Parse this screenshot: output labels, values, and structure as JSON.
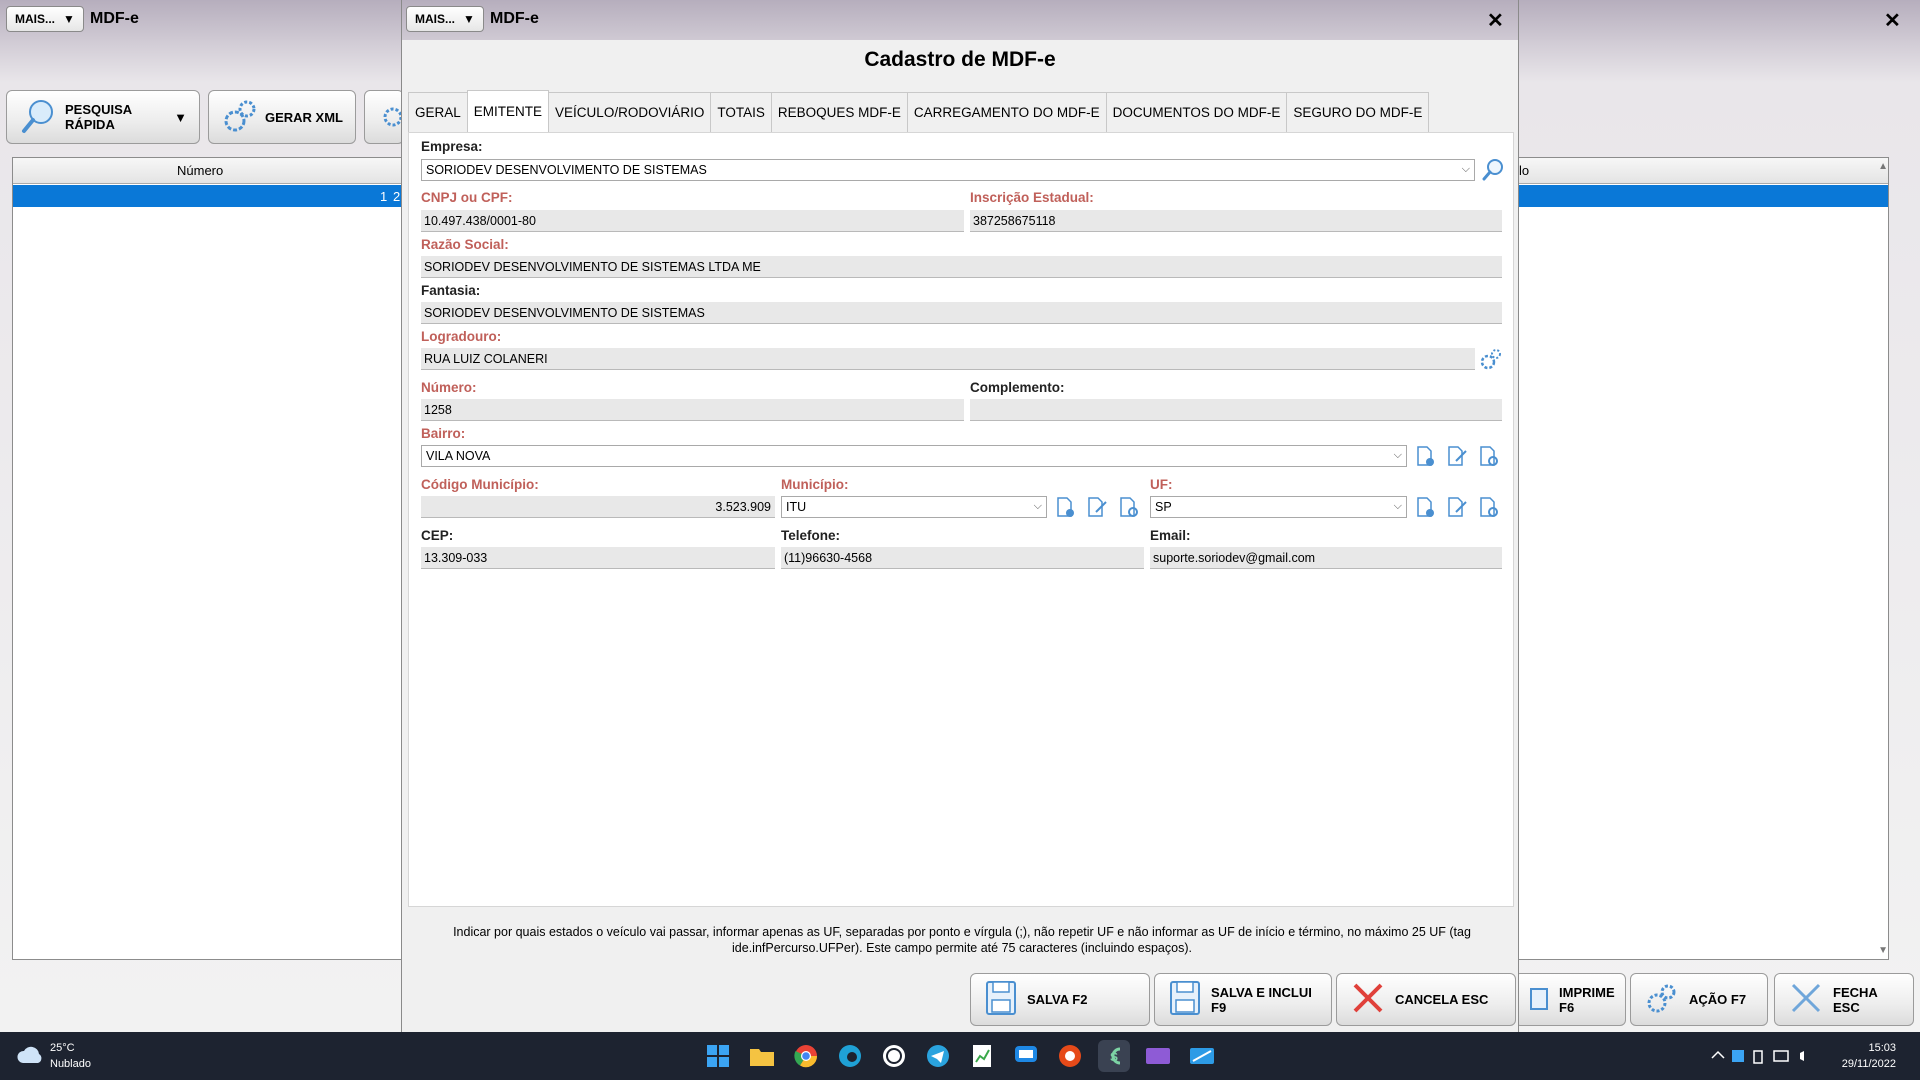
{
  "background_window": {
    "more_button": "MAIS...",
    "title": "MDF-e",
    "toolbar": {
      "quick_search": "PESQUISA RÁPIDA",
      "generate_xml": "GERAR XML"
    },
    "grid": {
      "col_numero": "Número",
      "col_right": "lo",
      "selected_row_value": "1",
      "selected_row_value2": "2"
    },
    "bottom": {
      "print": "IMPRIME F6",
      "action": "AÇÃO F7",
      "close": "FECHA ESC"
    }
  },
  "modal": {
    "more_button": "MAIS...",
    "window_title": "MDF-e",
    "heading": "Cadastro de MDF-e",
    "tabs": [
      {
        "label": "GERAL"
      },
      {
        "label": "EMITENTE"
      },
      {
        "label": "VEÍCULO/RODOVIÁRIO"
      },
      {
        "label": "TOTAIS"
      },
      {
        "label": "REBOQUES MDF-E"
      },
      {
        "label": "CARREGAMENTO DO MDF-E"
      },
      {
        "label": "DOCUMENTOS DO MDF-E"
      },
      {
        "label": "SEGURO DO MDF-E"
      }
    ],
    "active_tab": "EMITENTE",
    "form": {
      "empresa_label": "Empresa:",
      "empresa_value": "SORIODEV DESENVOLVIMENTO DE SISTEMAS",
      "cnpj_label": "CNPJ ou CPF:",
      "cnpj_value": "10.497.438/0001-80",
      "ie_label": "Inscrição Estadual:",
      "ie_value": "387258675118",
      "razao_label": "Razão Social:",
      "razao_value": "SORIODEV DESENVOLVIMENTO DE SISTEMAS LTDA ME",
      "fantasia_label": "Fantasia:",
      "fantasia_value": "SORIODEV DESENVOLVIMENTO DE SISTEMAS",
      "logradouro_label": "Logradouro:",
      "logradouro_value": "RUA LUIZ COLANERI",
      "numero_label": "Número:",
      "numero_value": "1258",
      "complemento_label": "Complemento:",
      "complemento_value": "",
      "bairro_label": "Bairro:",
      "bairro_value": "VILA NOVA",
      "cod_municipio_label": "Código Município:",
      "cod_municipio_value": "3.523.909",
      "municipio_label": "Município:",
      "municipio_value": "ITU",
      "uf_label": "UF:",
      "uf_value": "SP",
      "cep_label": "CEP:",
      "cep_value": "13.309-033",
      "telefone_label": "Telefone:",
      "telefone_value": "(11)96630-4568",
      "email_label": "Email:",
      "email_value": "suporte.soriodev@gmail.com"
    },
    "hint_line1": "Indicar por quais estados o veículo vai passar, informar apenas as UF, separadas por ponto e vírgula (;), não repetir UF e não informar as UF de início e término, no máximo 25 UF (tag",
    "hint_line2": "ide.infPercurso.UFPer). Este campo permite até 75 caracteres (incluindo espaços).",
    "buttons": {
      "save": "SALVA F2",
      "save_include": "SALVA E INCLUI F9",
      "cancel": "CANCELA ESC"
    }
  },
  "taskbar": {
    "temperature": "25°C",
    "condition": "Nublado",
    "time": "15:03",
    "date": "29/11/2022"
  },
  "colors": {
    "required_label": "#c0605a",
    "selection": "#0a78d7",
    "taskbar": "#1d2330"
  }
}
